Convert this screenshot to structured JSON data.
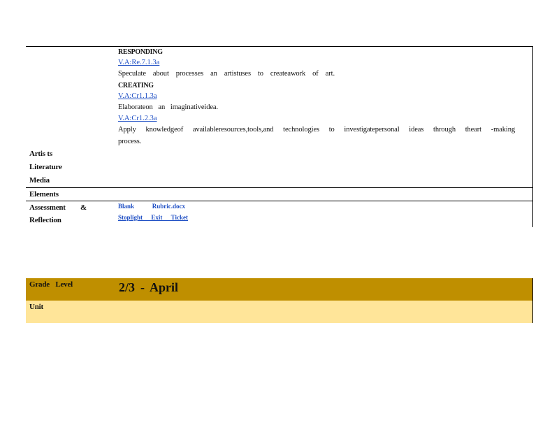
{
  "standards": {
    "responding_heading": "RESPONDING",
    "responding_code": "V.A:Re.7.1.3a",
    "responding_text": "Speculate about processes an artistuses to createawork of art.",
    "creating_heading": "CREATING",
    "creating_code_1": "V.A:Cr1.1.3a",
    "creating_text_1": "Elaborateon an imaginativeidea.",
    "creating_code_2": "V.A:Cr1.2.3a",
    "creating_text_2a": "Apply knowledgeof availableresources,tools,and technologies to investigatepersonal ideas through theart -making",
    "creating_text_2b": "process."
  },
  "labels": {
    "artists": "Artis ts",
    "literature": "Literature",
    "media": "Media",
    "elements": "Elements",
    "assessment": "Assessment",
    "ampersand": "&",
    "reflection": "Reflection"
  },
  "assessment_links": {
    "blank_rubric": "Blank Rubric.docx",
    "stoplight": "Stoplight Exit Ticket"
  },
  "grade": {
    "label": "Grade Level",
    "value": "2/3 - April",
    "unit_label": "Unit"
  }
}
